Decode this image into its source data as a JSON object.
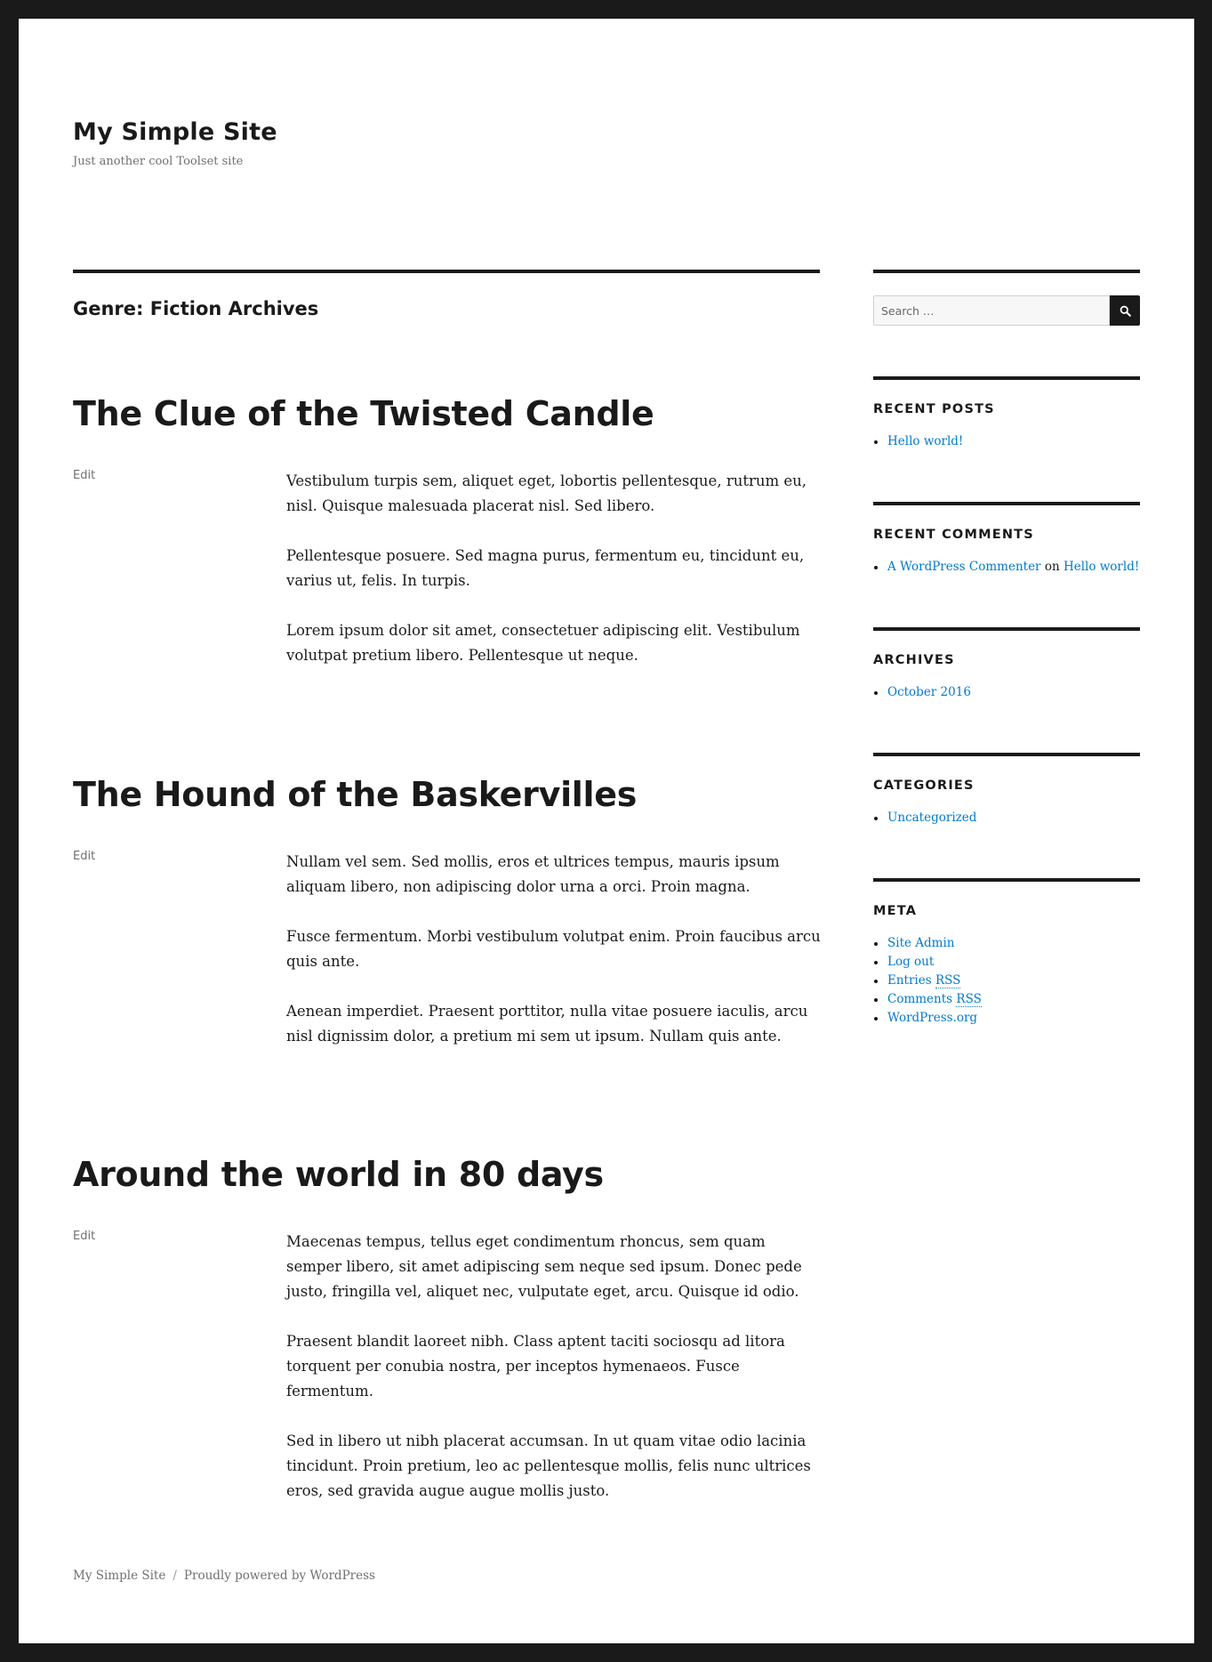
{
  "site": {
    "title": "My Simple Site",
    "description": "Just another cool Toolset site"
  },
  "archive": {
    "title": "Genre: Fiction Archives"
  },
  "articles": [
    {
      "title": "The Clue of the Twisted Candle",
      "edit_label": "Edit",
      "paragraphs": [
        "Vestibulum turpis sem, aliquet eget, lobortis pellentesque, rutrum eu, nisl. Quisque malesuada placerat nisl. Sed libero.",
        "Pellentesque posuere. Sed magna purus, fermentum eu, tincidunt eu, varius ut, felis. In turpis.",
        "Lorem ipsum dolor sit amet, consectetuer adipiscing elit. Vestibulum volutpat pretium libero. Pellentesque ut neque."
      ]
    },
    {
      "title": "The Hound of the Baskervilles",
      "edit_label": "Edit",
      "paragraphs": [
        "Nullam vel sem. Sed mollis, eros et ultrices tempus, mauris ipsum aliquam libero, non adipiscing dolor urna a orci. Proin magna.",
        "Fusce fermentum. Morbi vestibulum volutpat enim. Proin faucibus arcu quis ante.",
        "Aenean imperdiet. Praesent porttitor, nulla vitae posuere iaculis, arcu nisl dignissim dolor, a pretium mi sem ut ipsum. Nullam quis ante."
      ]
    },
    {
      "title": "Around the world in 80 days",
      "edit_label": "Edit",
      "paragraphs": [
        "Maecenas tempus, tellus eget condimentum rhoncus, sem quam semper libero, sit amet adipiscing sem neque sed ipsum. Donec pede justo, fringilla vel, aliquet nec, vulputate eget, arcu. Quisque id odio.",
        "Praesent blandit laoreet nibh. Class aptent taciti sociosqu ad litora torquent per conubia nostra, per inceptos hymenaeos. Fusce fermentum.",
        "Sed in libero ut nibh placerat accumsan. In ut quam vitae odio lacinia tincidunt. Proin pretium, leo ac pellentesque mollis, felis nunc ultrices eros, sed gravida augue augue mollis justo."
      ]
    }
  ],
  "sidebar": {
    "search": {
      "placeholder": "Search …",
      "value": "",
      "button_icon": "search-icon"
    },
    "recent_posts": {
      "title": "Recent Posts",
      "items": [
        "Hello world!"
      ]
    },
    "recent_comments": {
      "title": "Recent Comments",
      "items": [
        {
          "author": "A WordPress Commenter",
          "connector": "on",
          "post": "Hello world!"
        }
      ]
    },
    "archives": {
      "title": "Archives",
      "items": [
        "October 2016"
      ]
    },
    "categories": {
      "title": "Categories",
      "items": [
        "Uncategorized"
      ]
    },
    "meta": {
      "title": "Meta",
      "items": [
        {
          "label": "Site Admin"
        },
        {
          "label": "Log out"
        },
        {
          "label": "Entries",
          "abbr": "RSS"
        },
        {
          "label": "Comments",
          "abbr": "RSS"
        },
        {
          "label": "WordPress.org"
        }
      ]
    }
  },
  "footer": {
    "site_name": "My Simple Site",
    "separator": "/",
    "powered_by": "Proudly powered by WordPress"
  },
  "colors": {
    "frame": "#1a1a1a",
    "background": "#ffffff",
    "text": "#1a1a1a",
    "muted": "#707070",
    "link": "#007acc"
  }
}
